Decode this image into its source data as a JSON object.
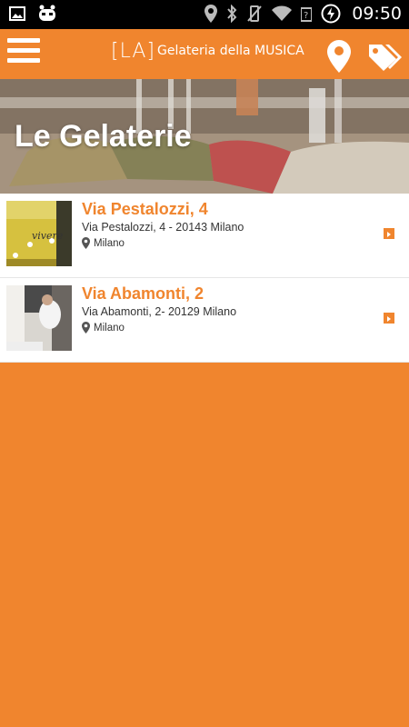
{
  "status_bar": {
    "time": "09:50",
    "icons": [
      "image-icon",
      "cyanogen-icon",
      "location-icon",
      "bluetooth-icon",
      "vibrate-off-icon",
      "wifi-icon",
      "signal-icon",
      "battery-icon"
    ]
  },
  "app_bar": {
    "logo_bracket": "[LA]",
    "logo_name": "Gelateria della MUSICA",
    "menu_icon": "menu-icon",
    "map_icon": "map-pin-icon",
    "tags_icon": "tags-icon"
  },
  "hero": {
    "title": "Le Gelaterie"
  },
  "stores": [
    {
      "title": "Via Pestalozzi, 4",
      "address": "Via Pestalozzi, 4 - 20143 Milano",
      "city": "Milano"
    },
    {
      "title": "Via Abamonti, 2",
      "address": "Via Abamonti, 2- 20129 Milano",
      "city": "Milano"
    }
  ],
  "colors": {
    "accent": "#f0852e",
    "list_bg": "#ffffff",
    "text": "#333333"
  }
}
